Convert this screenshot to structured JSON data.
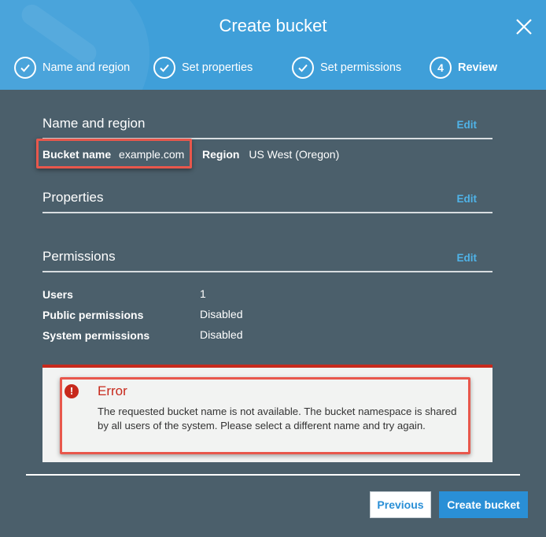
{
  "dialog": {
    "title": "Create bucket",
    "close_icon": "close-icon"
  },
  "steps": [
    {
      "label": "Name and region",
      "state": "complete",
      "icon": "check-icon"
    },
    {
      "label": "Set properties",
      "state": "complete",
      "icon": "check-icon"
    },
    {
      "label": "Set permissions",
      "state": "complete",
      "icon": "check-icon"
    },
    {
      "label": "Review",
      "state": "active",
      "number": "4"
    }
  ],
  "sections": {
    "name_region": {
      "title": "Name and region",
      "edit_label": "Edit",
      "bucket_name_label": "Bucket name",
      "bucket_name_value": "example.com",
      "region_label": "Region",
      "region_value": "US West (Oregon)"
    },
    "properties": {
      "title": "Properties",
      "edit_label": "Edit"
    },
    "permissions": {
      "title": "Permissions",
      "edit_label": "Edit",
      "rows": [
        {
          "label": "Users",
          "value": "1"
        },
        {
          "label": "Public permissions",
          "value": "Disabled"
        },
        {
          "label": "System permissions",
          "value": "Disabled"
        }
      ]
    }
  },
  "error": {
    "icon": "error-icon",
    "icon_glyph": "!",
    "title": "Error",
    "message": "The requested bucket name is not available. The bucket namespace is shared by all users of the system. Please select a different name and try again."
  },
  "footer": {
    "previous_label": "Previous",
    "create_label": "Create bucket"
  },
  "colors": {
    "header": "#3f9fd9",
    "body": "#4b5f6b",
    "accent": "#2a8fd6",
    "error": "#c7291c",
    "highlight": "#e8574c"
  }
}
